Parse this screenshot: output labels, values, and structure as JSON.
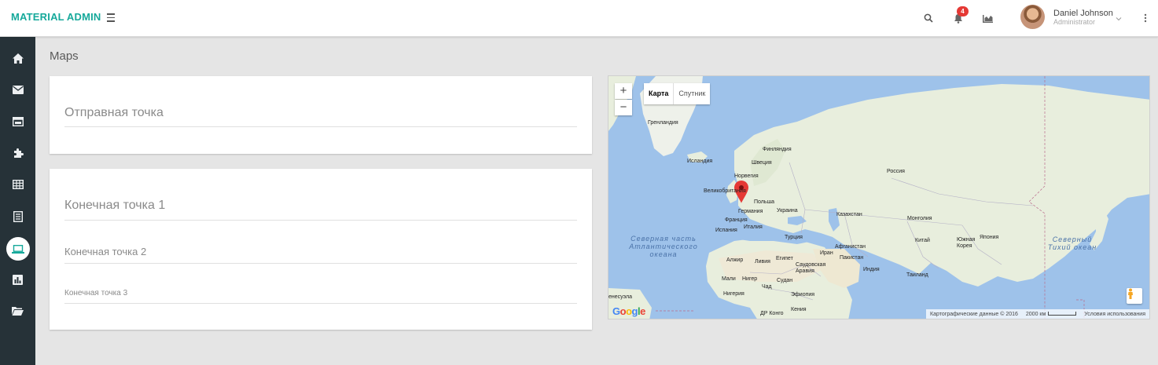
{
  "header": {
    "brand": "MATERIAL ADMIN",
    "notifications_count": "4",
    "user_name": "Daniel Johnson",
    "user_role": "Administrator",
    "brand_color": "#16a99b",
    "badge_color": "#e53935"
  },
  "sidebar": {
    "items": [
      {
        "icon": "home-icon"
      },
      {
        "icon": "mail-icon"
      },
      {
        "icon": "calendar-icon"
      },
      {
        "icon": "puzzle-icon"
      },
      {
        "icon": "table-icon"
      },
      {
        "icon": "form-icon"
      },
      {
        "icon": "laptop-icon",
        "active": true
      },
      {
        "icon": "chart-icon"
      },
      {
        "icon": "folder-icon"
      }
    ],
    "background": "#263238"
  },
  "page": {
    "title": "Maps"
  },
  "route_form": {
    "origin_placeholder": "Отправная точка",
    "destination_1_placeholder": "Конечная точка 1",
    "destination_2_placeholder": "Конечная точка 2",
    "destination_3_placeholder": "Конечная точка 3"
  },
  "map": {
    "type_map": "Карта",
    "type_satellite": "Спутник",
    "zoom_in": "+",
    "zoom_out": "−",
    "labels": {
      "greenland": "Гренландия",
      "iceland": "Исландия",
      "finland": "Финляндия",
      "sweden": "Швеция",
      "norway": "Норвегия",
      "uk": "Великобритания",
      "poland": "Польша",
      "germany": "Германия",
      "ukraine": "Украина",
      "france": "Франция",
      "italy": "Италия",
      "spain": "Испания",
      "russia": "Россия",
      "kazakhstan": "Казахстан",
      "mongolia": "Монголия",
      "turkey": "Турция",
      "afghanistan": "Афганистан",
      "iran": "Иран",
      "pakistan": "Пакистан",
      "china": "Китай",
      "korea": "Южная Корея",
      "japan": "Япония",
      "algeria": "Алжир",
      "libya": "Ливия",
      "egypt": "Египет",
      "saudi": "Саудовская Аравия",
      "india": "Индия",
      "thailand": "Таиланд",
      "mali": "Мали",
      "niger": "Нигер",
      "sudan": "Судан",
      "chad": "Чад",
      "nigeria": "Нигерия",
      "ethiopia": "Эфиопия",
      "drc": "ДР Конго",
      "kenya": "Кения",
      "venezuela": "енесуэла"
    },
    "ocean_atlantic": "Северная часть Атлантического океана",
    "ocean_pacific": "Северный Тихий океан",
    "attribution": "Картографические данные © 2016",
    "scale": "2000 км",
    "terms": "Условия использования",
    "google": "Google",
    "land_color": "#e8eedd",
    "water_color": "#9ec2ea"
  }
}
